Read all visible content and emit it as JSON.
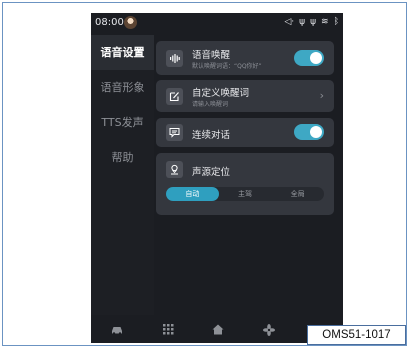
{
  "status": {
    "time": "08:00",
    "icons": [
      "audio-out-icon",
      "usb-icon",
      "usb-icon-2",
      "wifi-icon",
      "bluetooth-icon"
    ]
  },
  "sidebar": {
    "items": [
      {
        "label": "语音设置",
        "active": true
      },
      {
        "label": "语音形象",
        "active": false
      },
      {
        "label": "TTS发声",
        "active": false
      },
      {
        "label": "帮助",
        "active": false
      }
    ]
  },
  "cards": {
    "wake": {
      "title": "语音唤醒",
      "subtitle": "默认唤醒词语：“QQ你好”",
      "on": true
    },
    "custom": {
      "title": "自定义唤醒词",
      "subtitle": "请输入唤醒词"
    },
    "continuous": {
      "title": "连续对话",
      "on": true
    },
    "source": {
      "title": "声源定位",
      "options": [
        "自动",
        "主驾",
        "全局"
      ],
      "selected": "自动"
    }
  },
  "dock": {
    "icons": [
      "car-icon",
      "apps-grid-icon",
      "home-icon",
      "fan-icon",
      "settings-icon"
    ]
  },
  "caption": "OMS51-1017",
  "colors": {
    "accent": "#3ea8c4",
    "card": "#34373e",
    "screen": "#1b1d22"
  }
}
